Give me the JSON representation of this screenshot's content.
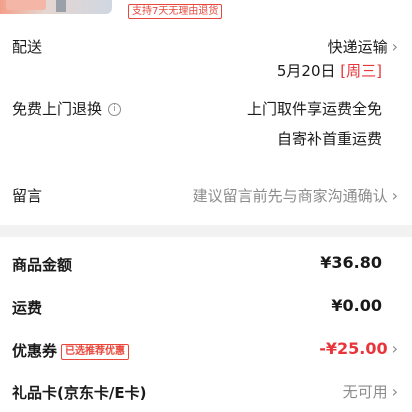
{
  "product": {
    "return_tag": "支持7天无理由退货"
  },
  "delivery": {
    "label": "配送",
    "method": "快递运输",
    "date": "5月20日",
    "weekday": "[周三]"
  },
  "free_return": {
    "label": "免费上门退换",
    "line1": "上门取件享运费全免",
    "line2": "自寄补首重运费"
  },
  "message": {
    "label": "留言",
    "placeholder": "建议留言前先与商家沟通确认"
  },
  "summary": {
    "goods_amount_label": "商品金额",
    "goods_amount": "¥36.80",
    "shipping_label": "运费",
    "shipping": "¥0.00",
    "coupon_label": "优惠券",
    "coupon_tag": "已选推荐优惠",
    "coupon_value": "-¥25.00",
    "giftcard_label": "礼品卡(京东卡/E卡)",
    "giftcard_value": "无可用"
  },
  "colors": {
    "accent_red": "#e8343a",
    "divider": "#f2f2f2"
  },
  "icons": {
    "chevron": "chevron-right-icon",
    "info": "info-icon"
  }
}
